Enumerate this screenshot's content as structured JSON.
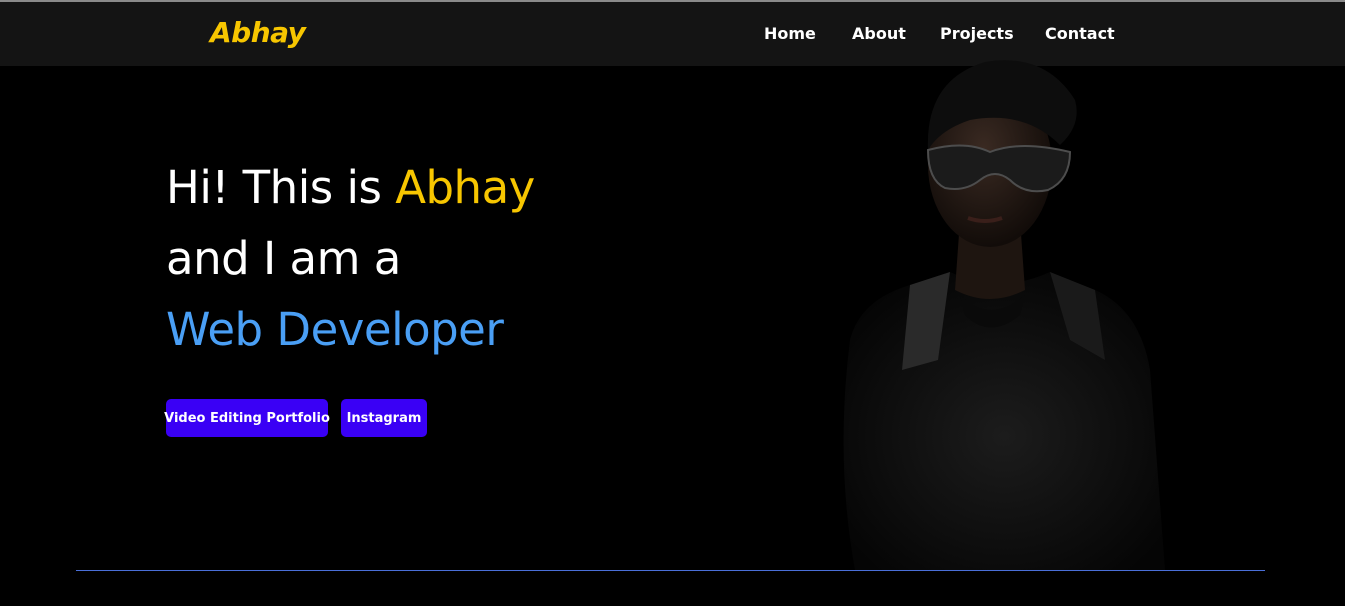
{
  "brand": {
    "name": "Abhay",
    "color": "#f7c600"
  },
  "nav": {
    "items": [
      {
        "label": "Home"
      },
      {
        "label": "About"
      },
      {
        "label": "Projects"
      },
      {
        "label": "Contact"
      }
    ]
  },
  "hero": {
    "line1_prefix": "Hi! This is ",
    "line1_name": "Abhay",
    "line2": "and I am a",
    "line3_role": "Web Developer",
    "role_color": "#4a9ff5"
  },
  "buttons": {
    "video_editing_label": "Video Editing Portfolio",
    "instagram_label": "Instagram",
    "color": "#3a00f5"
  },
  "portrait": {
    "icon": "person-portrait-icon"
  }
}
